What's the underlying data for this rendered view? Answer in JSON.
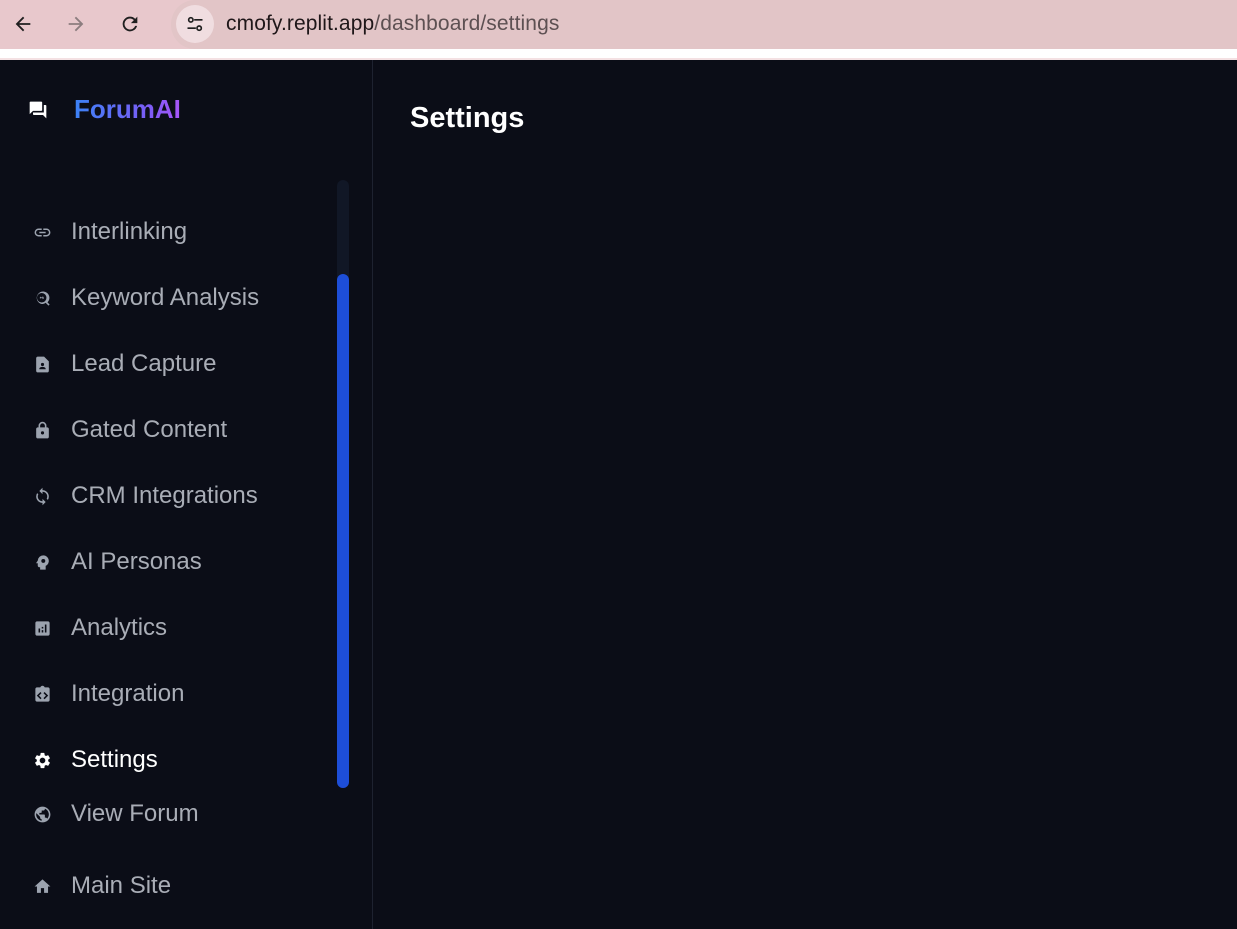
{
  "browser": {
    "url_host": "cmofy.replit.app",
    "url_path": "/dashboard/settings"
  },
  "brand": {
    "name": "ForumAI",
    "icon": "forum-icon"
  },
  "sidebar": {
    "items": [
      {
        "label": "Interlinking",
        "icon": "link-icon"
      },
      {
        "label": "Keyword Analysis",
        "icon": "search-insights-icon"
      },
      {
        "label": "Lead Capture",
        "icon": "contact-page-icon"
      },
      {
        "label": "Gated Content",
        "icon": "lock-icon"
      },
      {
        "label": "CRM Integrations",
        "icon": "sync-icon"
      },
      {
        "label": "AI Personas",
        "icon": "psychology-icon"
      },
      {
        "label": "Analytics",
        "icon": "analytics-icon"
      },
      {
        "label": "Integration",
        "icon": "integration-icon"
      },
      {
        "label": "Settings",
        "icon": "gear-icon",
        "active": true
      },
      {
        "label": "View Forum",
        "icon": "globe-icon"
      },
      {
        "label": "Main Site",
        "icon": "home-icon"
      }
    ]
  },
  "main": {
    "title": "Settings"
  },
  "colors": {
    "background": "#0b0d17",
    "accent": "#1d4ed8",
    "brand_gradient_start": "#3b82f6",
    "brand_gradient_end": "#a855f7"
  }
}
